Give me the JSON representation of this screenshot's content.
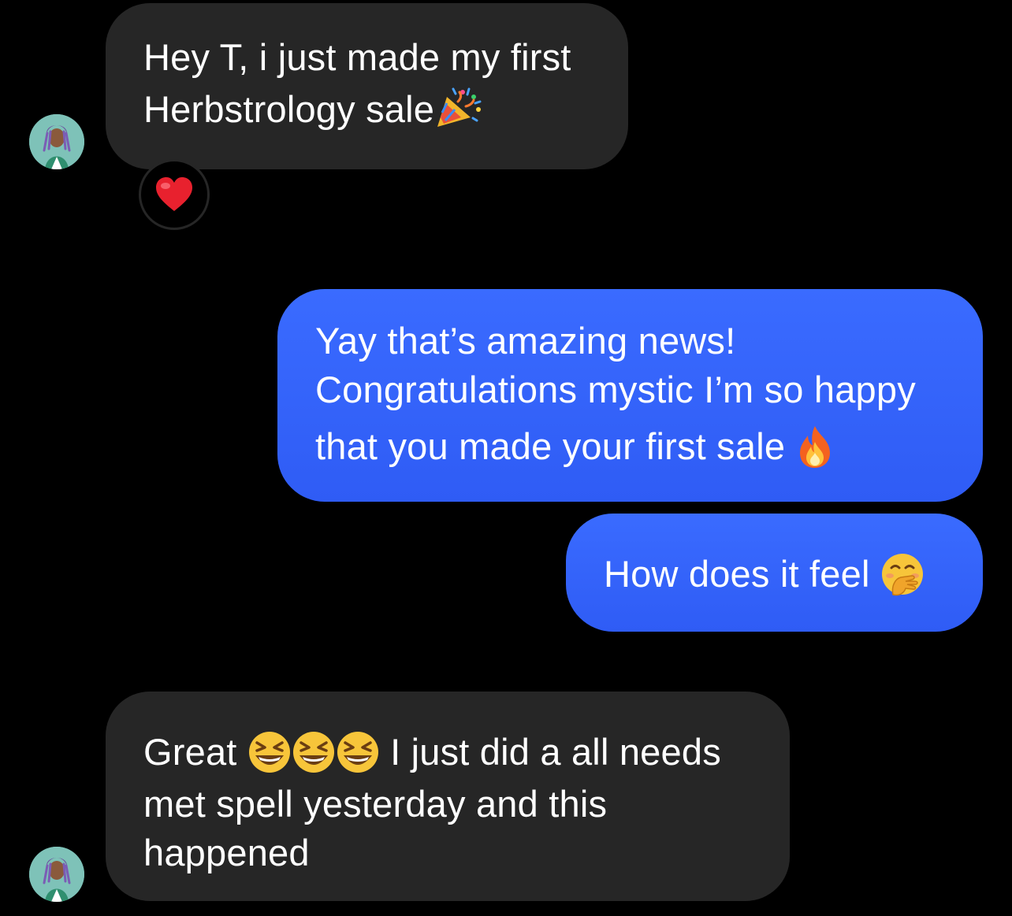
{
  "conversation": {
    "messages": [
      {
        "sender": "incoming",
        "lines": [
          "Hey T, i just made my first",
          "Herbstrology sale"
        ],
        "trailing_emoji": "party-popper"
      },
      {
        "sender": "outgoing",
        "lines": [
          "Yay that’s amazing news!",
          "Congratulations mystic I’m so happy",
          "that you made your first sale"
        ],
        "trailing_emoji": "fire"
      },
      {
        "sender": "outgoing",
        "lines": [
          "How does it feel"
        ],
        "trailing_emoji": "face-with-hand-over-mouth"
      },
      {
        "sender": "incoming",
        "lines": [
          "Great",
          "I just did a all needs",
          "met spell yesterday and this",
          "happened"
        ],
        "inline_emojis": [
          "grinning-squinting-face",
          "grinning-squinting-face",
          "grinning-squinting-face"
        ]
      }
    ],
    "reaction": {
      "emoji": "red-heart",
      "on_message": 0
    }
  },
  "colors": {
    "background": "#000000",
    "incoming_bubble": "#262626",
    "outgoing_bubble": "#3366ff",
    "text": "#ffffff"
  }
}
